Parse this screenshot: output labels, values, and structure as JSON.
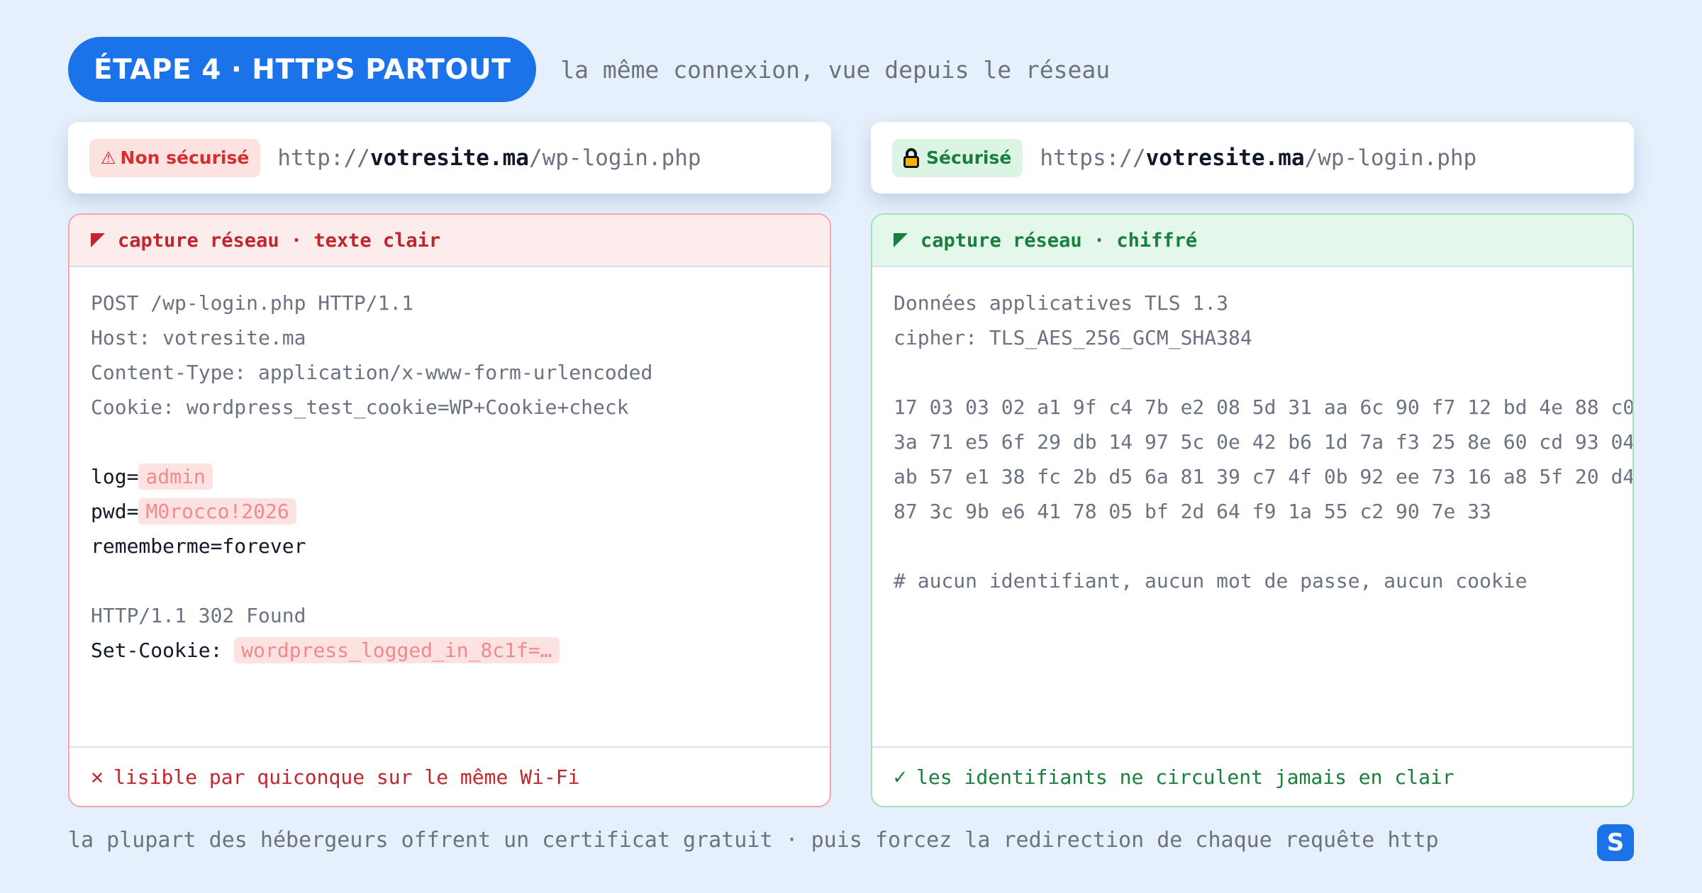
{
  "header": {
    "step": "ÉTAPE 4 · HTTPS PARTOUT",
    "subtitle": "la même connexion, vue depuis le réseau"
  },
  "left": {
    "badge": "Non sécurisé",
    "badge_icon": "warning-icon",
    "url": {
      "scheme": "http://",
      "domain": "votresite.ma",
      "path": "/wp-login.php"
    },
    "card_title": "capture réseau · texte clair",
    "request_lines": [
      "POST /wp-login.php HTTP/1.1",
      "Host: votresite.ma",
      "Content-Type: application/x-www-form-urlencoded",
      "Cookie: wordpress_test_cookie=WP+Cookie+check"
    ],
    "form": {
      "log_key": "log=",
      "log_value": "admin",
      "pwd_key": "pwd=",
      "pwd_value": "M0rocco!2026",
      "remember": "rememberme=forever"
    },
    "response": {
      "status": "HTTP/1.1 302 Found",
      "set_cookie_key": "Set-Cookie: ",
      "set_cookie_value": "wordpress_logged_in_8c1f=…"
    },
    "footer": "lisible par quiconque sur le même Wi-Fi",
    "footer_icon": "cross-icon"
  },
  "right": {
    "badge": "Sécurisé",
    "badge_icon": "lock-icon",
    "url": {
      "scheme": "https://",
      "domain": "votresite.ma",
      "path": "/wp-login.php"
    },
    "card_title": "capture réseau · chiffré",
    "info_lines": [
      "Données applicatives TLS 1.3",
      "cipher: TLS_AES_256_GCM_SHA384"
    ],
    "hex_lines": [
      "17 03 03 02 a1 9f c4 7b e2 08 5d 31 aa 6c 90 f7 12 bd 4e 88 c0",
      "3a 71 e5 6f 29 db 14 97 5c 0e 42 b6 1d 7a f3 25 8e 60 cd 93 04",
      "ab 57 e1 38 fc 2b d5 6a 81 39 c7 4f 0b 92 ee 73 16 a8 5f 20 d4",
      "87 3c 9b e6 41 78 05 bf 2d 64 f9 1a 55 c2 90 7e 33"
    ],
    "comment": "# aucun identifiant, aucun mot de passe, aucun cookie",
    "footer": "les identifiants ne circulent jamais en clair",
    "footer_icon": "check-icon"
  },
  "footer_note": "la plupart des hébergeurs offrent un certificat gratuit · puis forcez la redirection de chaque requête http",
  "logo_letter": "S",
  "colors": {
    "accent": "#1a73e8",
    "danger": "#c0262d",
    "success": "#1a7f3c",
    "background": "#e6f0fc"
  }
}
